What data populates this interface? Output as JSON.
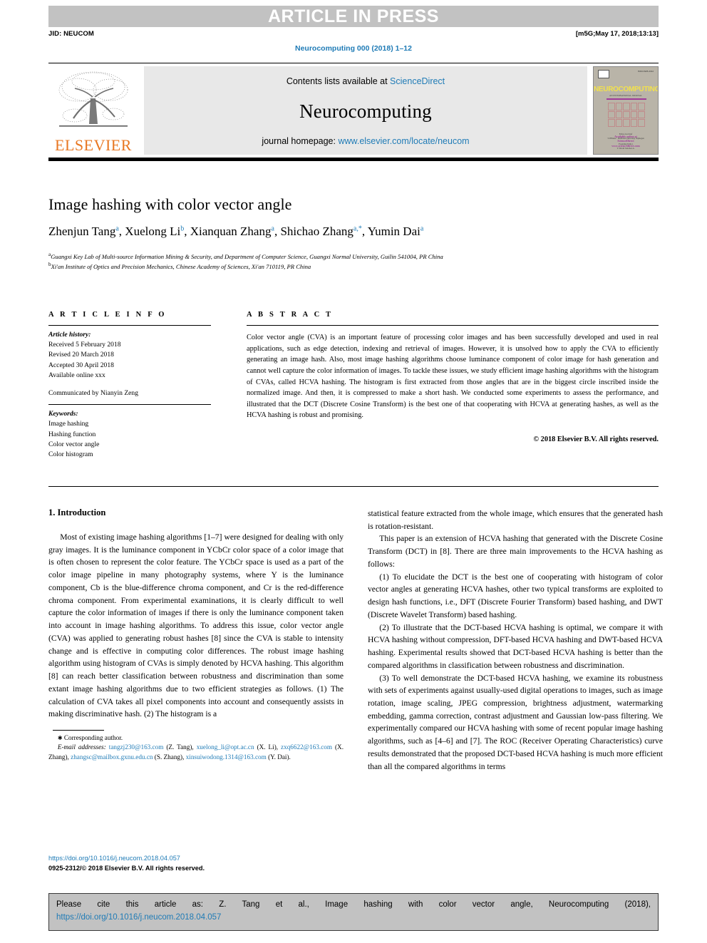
{
  "header": {
    "banner": "ARTICLE IN PRESS",
    "jid": "JID: NEUCOM",
    "build_tag": "[m5G;May 17, 2018;13:13]",
    "journal_ref": "Neurocomputing 000 (2018) 1–12"
  },
  "masthead": {
    "contents_prefix": "Contents lists available at ",
    "contents_link": "ScienceDirect",
    "journal_name": "Neurocomputing",
    "homepage_prefix": "journal homepage: ",
    "homepage_link": "www.elsevier.com/locate/neucom",
    "publisher": "ELSEVIER",
    "cover": {
      "title": "NEUROCOMPUTING",
      "issn": "ISSN 0925-2312",
      "subtitle": "AN INTERNATIONAL JOURNAL",
      "block1": "Editor-in-Chief",
      "block2": "T. HEskes  ·  Radboud University Nijmegen",
      "block3": "Founding Editor",
      "block4": "V. David Sánchez A.",
      "footer1": "Available online at",
      "footer2": "ScienceDirect",
      "footer3": "www.sciencedirect.com"
    }
  },
  "article": {
    "title": "Image hashing with color vector angle",
    "authors": [
      {
        "name": "Zhenjun Tang",
        "sup": "a"
      },
      {
        "name": "Xuelong Li",
        "sup": "b"
      },
      {
        "name": "Xianquan Zhang",
        "sup": "a"
      },
      {
        "name": "Shichao Zhang",
        "sup": "a,*"
      },
      {
        "name": "Yumin Dai",
        "sup": "a"
      }
    ],
    "affiliations": [
      {
        "label": "a",
        "text": "Guangxi Key Lab of Multi-source Information Mining & Security, and Department of Computer Science, Guangxi Normal University, Guilin 541004, PR China"
      },
      {
        "label": "b",
        "text": "Xi'an Institute of Optics and Precision Mechanics, Chinese Academy of Sciences, Xi'an 710119, PR China"
      }
    ]
  },
  "article_info": {
    "heading": "A R T I C L E   I N F O",
    "history_label": "Article history:",
    "history": [
      "Received 5 February 2018",
      "Revised 20 March 2018",
      "Accepted 30 April 2018",
      "Available online xxx"
    ],
    "communicated": "Communicated by Nianyin Zeng",
    "keywords_label": "Keywords:",
    "keywords": [
      "Image hashing",
      "Hashing function",
      "Color vector angle",
      "Color histogram"
    ]
  },
  "abstract": {
    "heading": "A B S T R A C T",
    "text": "Color vector angle (CVA) is an important feature of processing color images and has been successfully developed and used in real applications, such as edge detection, indexing and retrieval of images. However, it is unsolved how to apply the CVA to efficiently generating an image hash. Also, most image hashing algorithms choose luminance component of color image for hash generation and cannot well capture the color information of images. To tackle these issues, we study efficient image hashing algorithms with the histogram of CVAs, called HCVA hashing. The histogram is first extracted from those angles that are in the biggest circle inscribed inside the normalized image. And then, it is compressed to make a short hash. We conducted some experiments to assess the performance, and illustrated that the DCT (Discrete Cosine Transform) is the best one of that cooperating with HCVA at generating hashes, as well as the HCVA hashing is robust and promising.",
    "copyright": "© 2018 Elsevier B.V. All rights reserved."
  },
  "body": {
    "section_heading": "1. Introduction",
    "left_paragraphs": [
      "Most of existing image hashing algorithms [1–7] were designed for dealing with only gray images. It is the luminance component in YCbCr color space of a color image that is often chosen to represent the color feature. The YCbCr space is used as a part of the color image pipeline in many photography systems, where Y is the luminance component, Cb is the blue-difference chroma component, and Cr is the red-difference chroma component. From experimental examinations, it is clearly difficult to well capture the color information of images if there is only the luminance component taken into account in image hashing algorithms. To address this issue, color vector angle (CVA) was applied to generating robust hashes [8] since the CVA is stable to intensity change and is effective in computing color differences. The robust image hashing algorithm using histogram of CVAs is simply denoted by HCVA hashing. This algorithm [8] can reach better classification between robustness and discrimination than some extant image hashing algorithms due to two efficient strategies as follows. (1) The calculation of CVA takes all pixel components into account and consequently assists in making discriminative hash. (2) The histogram is a"
    ],
    "right_paragraphs": [
      "statistical feature extracted from the whole image, which ensures that the generated hash is rotation-resistant.",
      "This paper is an extension of HCVA hashing that generated with the Discrete Cosine Transform (DCT) in [8]. There are three main improvements to the HCVA hashing as follows:",
      "(1) To elucidate the DCT is the best one of cooperating with histogram of color vector angles at generating HCVA hashes, other two typical transforms are exploited to design hash functions, i.e., DFT (Discrete Fourier Transform) based hashing, and DWT (Discrete Wavelet Transform) based hashing.",
      "(2) To illustrate that the DCT-based HCVA hashing is optimal, we compare it with HCVA hashing without compression, DFT-based HCVA hashing and DWT-based HCVA hashing. Experimental results showed that DCT-based HCVA hashing is better than the compared algorithms in classification between robustness and discrimination.",
      "(3) To well demonstrate the DCT-based HCVA hashing, we examine its robustness with sets of experiments against usually-used digital operations to images, such as image rotation, image scaling, JPEG compression, brightness adjustment, watermarking embedding, gamma correction, contrast adjustment and Gaussian low-pass filtering. We experimentally compared our HCVA hashing with some of recent popular image hashing algorithms, such as [4–6] and [7]. The ROC (Receiver Operating Characteristics) curve results demonstrated that the proposed DCT-based HCVA hashing is much more efficient than all the compared algorithms in terms"
    ]
  },
  "footnote": {
    "corresponding": "Corresponding author.",
    "email_label": "E-mail addresses:",
    "emails": [
      {
        "addr": "tangzj230@163.com",
        "who": "(Z. Tang),"
      },
      {
        "addr": "xuelong_li@opt.ac.cn",
        "who": "(X. Li),"
      },
      {
        "addr": "zxq6622@163.com",
        "who": "(X. Zhang),"
      },
      {
        "addr": "zhangsc@mailbox.gxnu.edu.cn",
        "who": "(S. Zhang),"
      },
      {
        "addr": "xinsuiwodong.1314@163.com",
        "who": "(Y. Dai)."
      }
    ],
    "doi": "https://doi.org/10.1016/j.neucom.2018.04.057",
    "issn_line": "0925-2312/© 2018 Elsevier B.V. All rights reserved."
  },
  "cite_box": {
    "text": "Please cite this article as: Z. Tang et al., Image hashing with color vector angle, Neurocomputing (2018),",
    "doi": "https://doi.org/10.1016/j.neucom.2018.04.057"
  },
  "colors": {
    "link": "#1f7bb6",
    "banner_bg": "#c2c2c2",
    "elsevier_orange": "#e87722"
  }
}
